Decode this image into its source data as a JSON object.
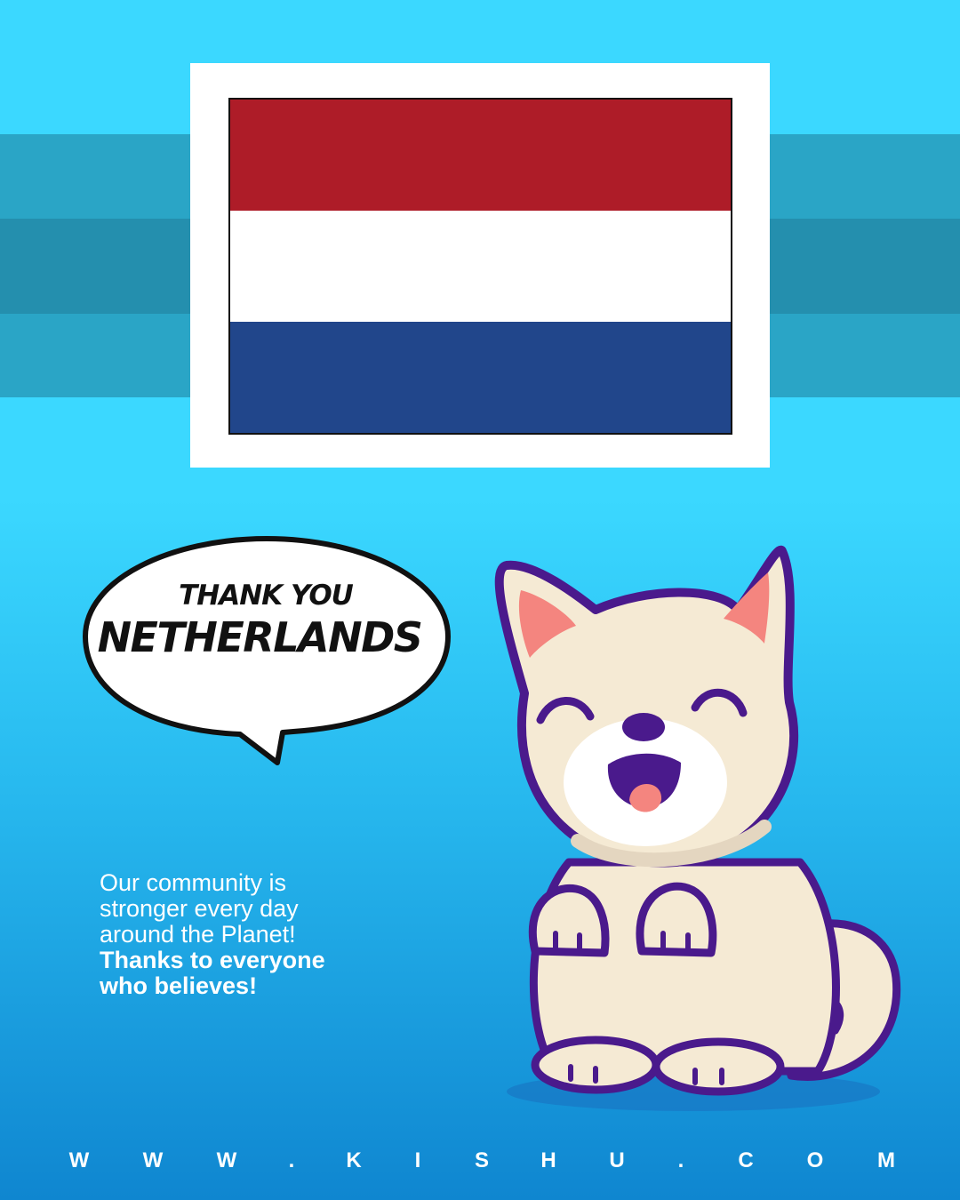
{
  "flag": {
    "stripes": [
      "#ae1c28",
      "#ffffff",
      "#21468b"
    ]
  },
  "bubble": {
    "line1": "THANK YOU",
    "line2": "NETHERLANDS"
  },
  "message": {
    "lines": [
      "Our community is",
      "stronger every day",
      "around the Planet!"
    ],
    "bold_lines": [
      "Thanks to everyone",
      "who believes!"
    ]
  },
  "footer": {
    "characters": [
      "W",
      "W",
      "W",
      ".",
      "K",
      "I",
      "S",
      "H",
      "U",
      ".",
      "C",
      "O",
      "M"
    ]
  },
  "mascot": {
    "icon": "dog-icon"
  },
  "colors": {
    "background": "#3bd8ff",
    "band_light": "#2aa5c6",
    "band_dark": "#248fae",
    "mascot_outline": "#4a1a8c",
    "mascot_fur": "#f5ead4"
  }
}
